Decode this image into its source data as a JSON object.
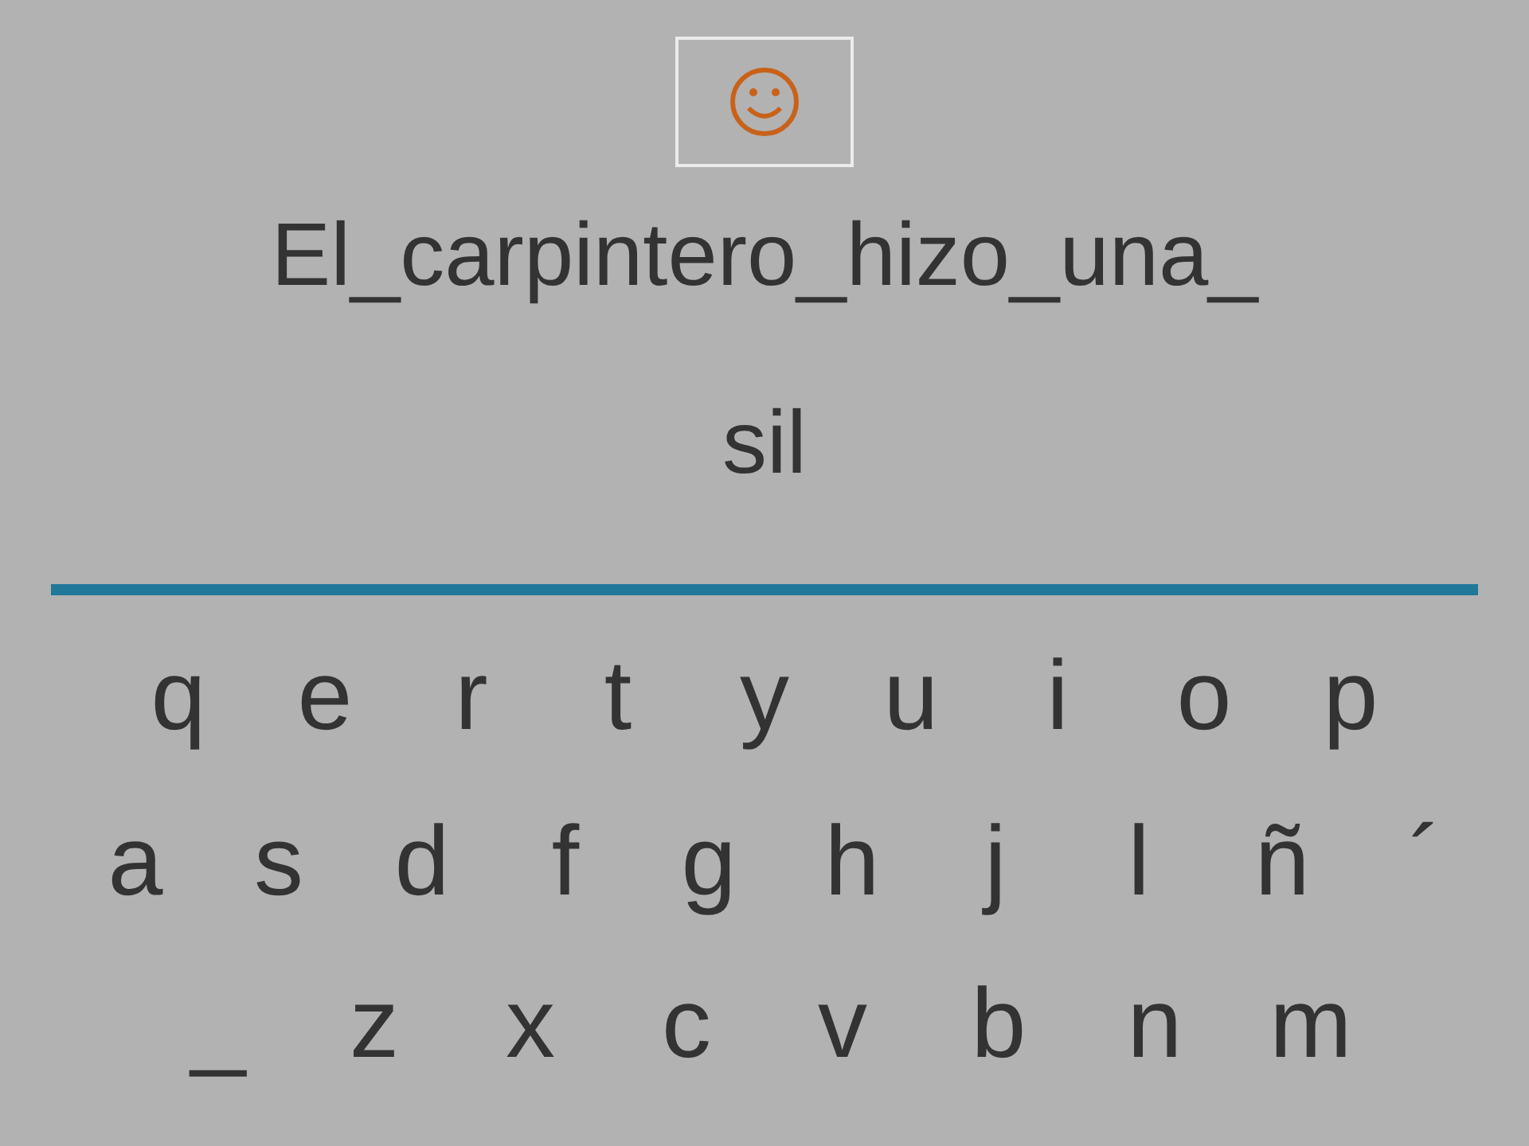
{
  "sentence": [
    "El_carpintero_hizo_una_",
    "sil"
  ],
  "keyboard": [
    [
      "q",
      "e",
      "r",
      "t",
      "y",
      "u",
      "i",
      "o",
      "p"
    ],
    [
      "a",
      "s",
      "d",
      "f",
      "g",
      "h",
      "j",
      "l",
      "ñ",
      "´"
    ],
    [
      "_",
      "z",
      "x",
      "c",
      "v",
      "b",
      "n",
      "m"
    ]
  ]
}
